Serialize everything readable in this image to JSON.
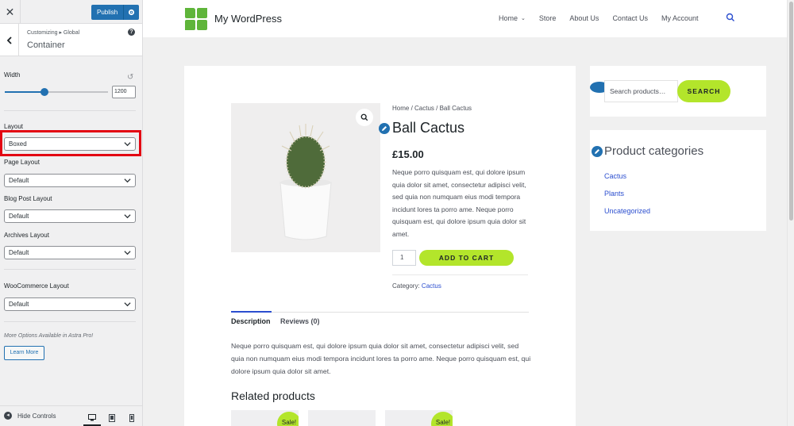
{
  "customizer": {
    "publish_label": "Publish",
    "breadcrumb": "Customizing ▸ Global",
    "section_title": "Container",
    "width_label": "Width",
    "width_value": "1200",
    "width_slider_fraction": 0.38,
    "layout_label": "Layout",
    "layout_value": "Boxed",
    "page_layout_label": "Page Layout",
    "page_layout_value": "Default",
    "blog_layout_label": "Blog Post Layout",
    "blog_layout_value": "Default",
    "archives_layout_label": "Archives Layout",
    "archives_layout_value": "Default",
    "woo_layout_label": "WooCommerce Layout",
    "woo_layout_value": "Default",
    "pro_note": "More Options Available in Astra Pro!",
    "learn_more_label": "Learn More",
    "hide_controls_label": "Hide Controls",
    "accent_color": "#2271b1",
    "highlight_color": "#e30613"
  },
  "site": {
    "name": "My WordPress",
    "nav": [
      "Home",
      "Store",
      "About Us",
      "Contact Us",
      "My Account"
    ],
    "accent_green": "#b3e52b",
    "link_blue": "#2b4ecf"
  },
  "product": {
    "breadcrumb": "Home / Cactus / Ball Cactus",
    "title": "Ball Cactus",
    "price": "£15.00",
    "short_description": "Neque porro quisquam est, qui dolore ipsum quia dolor sit amet, consectetur adipisci velit, sed quia non numquam eius modi tempora incidunt lores ta porro ame. Neque porro quisquam est, qui dolore ipsum quia dolor sit amet.",
    "quantity": "1",
    "add_to_cart_label": "ADD TO CART",
    "category_label": "Category:",
    "category_value": "Cactus",
    "tab_description": "Description",
    "tab_reviews": "Reviews (0)",
    "long_description": "Neque porro quisquam est, qui dolore ipsum quia dolor sit amet, consectetur adipisci velit, sed quia non numquam eius modi tempora incidunt lores ta porro ame. Neque porro quisquam est, qui dolore ipsum quia dolor sit amet.",
    "related_title": "Related products",
    "sale_badge": "Sale!"
  },
  "widgets": {
    "search_placeholder": "Search products…",
    "search_button": "SEARCH",
    "categories_title": "Product categories",
    "categories": [
      "Cactus",
      "Plants",
      "Uncategorized"
    ]
  }
}
